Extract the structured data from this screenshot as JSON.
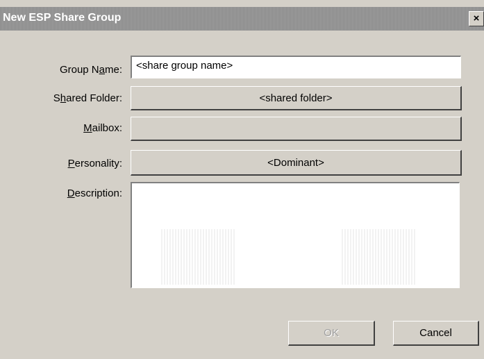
{
  "window": {
    "title": "New ESP Share Group",
    "close_glyph": "×"
  },
  "form": {
    "group_name": {
      "label_pre": "Group N",
      "label_key": "a",
      "label_post": "me:",
      "value": "<share group name>"
    },
    "shared_folder": {
      "label_pre": "S",
      "label_key": "h",
      "label_post": "ared Folder:",
      "button_text": "<shared folder>"
    },
    "mailbox": {
      "label_pre": "",
      "label_key": "M",
      "label_post": "ailbox:",
      "button_text": ""
    },
    "personality": {
      "label_pre": "",
      "label_key": "P",
      "label_post": "ersonality:",
      "button_text": "<Dominant>"
    },
    "description": {
      "label_pre": "",
      "label_key": "D",
      "label_post": "escription:",
      "value": ""
    }
  },
  "buttons": {
    "ok": "OK",
    "cancel": "Cancel"
  }
}
